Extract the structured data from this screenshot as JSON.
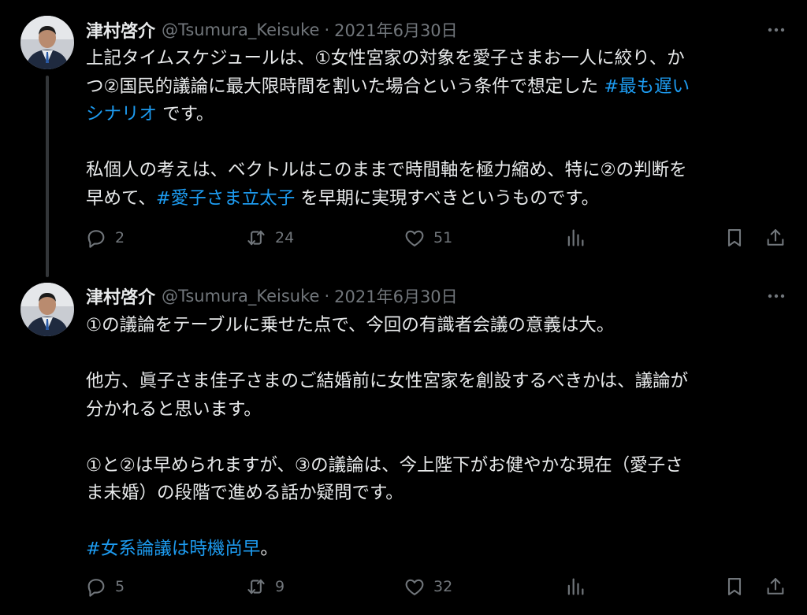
{
  "tweets": [
    {
      "author": {
        "name": "津村啓介",
        "handle": "@Tsumura_Keisuke",
        "date": "2021年6月30日"
      },
      "lines": [
        [
          {
            "t": "上記タイムスケジュールは、①女性宮家の対象を愛子さまお一人に絞り、か"
          }
        ],
        [
          {
            "t": "つ②国民的議論に最大限時間を割いた場合という条件で想定した "
          },
          {
            "t": "#最も遅い",
            "tag": true
          }
        ],
        [
          {
            "t": "シナリオ",
            "tag": true
          },
          {
            "t": " です。"
          }
        ],
        [],
        [
          {
            "t": "私個人の考えは、ベクトルはこのままで時間軸を極力縮め、特に②の判断を"
          }
        ],
        [
          {
            "t": "早めて、"
          },
          {
            "t": "#愛子さま立太子",
            "tag": true
          },
          {
            "t": " を早期に実現すべきというものです。"
          }
        ]
      ],
      "actions": {
        "replies": "2",
        "retweets": "24",
        "likes": "51"
      }
    },
    {
      "author": {
        "name": "津村啓介",
        "handle": "@Tsumura_Keisuke",
        "date": "2021年6月30日"
      },
      "lines": [
        [
          {
            "t": "①の議論をテーブルに乗せた点で、今回の有識者会議の意義は大。"
          }
        ],
        [],
        [
          {
            "t": "他方、眞子さま佳子さまのご結婚前に女性宮家を創設するべきかは、議論が"
          }
        ],
        [
          {
            "t": "分かれると思います。"
          }
        ],
        [],
        [
          {
            "t": "①と②は早められますが、③の議論は、今上陛下がお健やかな現在（愛子さ"
          }
        ],
        [
          {
            "t": "ま未婚）の段階で進める話か疑問です。"
          }
        ],
        [],
        [
          {
            "t": "#女系論議は時機尚早",
            "tag": true
          },
          {
            "t": "。"
          }
        ]
      ],
      "actions": {
        "replies": "5",
        "retweets": "9",
        "likes": "32"
      }
    }
  ],
  "colors": {
    "background": "#000000",
    "text": "#e7e9ea",
    "muted": "#71767b",
    "link": "#1d9bf0",
    "thread_line": "#333639"
  },
  "icons": [
    "reply-icon",
    "retweet-icon",
    "like-icon",
    "views-icon",
    "bookmark-icon",
    "share-icon",
    "more-icon"
  ]
}
